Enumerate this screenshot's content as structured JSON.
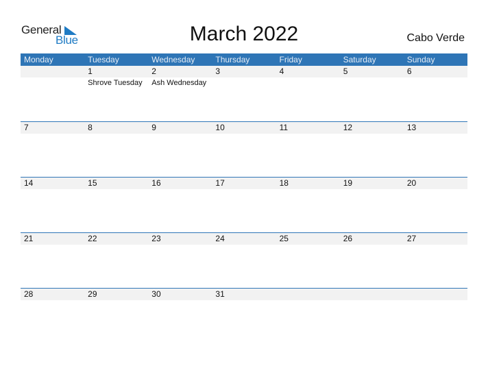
{
  "brand": {
    "general": "General",
    "blue": "Blue"
  },
  "title": "March 2022",
  "country": "Cabo Verde",
  "colors": {
    "accent": "#2e75b6",
    "strip": "#f2f2f2",
    "logo_blue": "#1f7bc4"
  },
  "weekdays": [
    "Monday",
    "Tuesday",
    "Wednesday",
    "Thursday",
    "Friday",
    "Saturday",
    "Sunday"
  ],
  "weeks": [
    [
      {
        "day": ""
      },
      {
        "day": "1",
        "holiday": "Shrove Tuesday"
      },
      {
        "day": "2",
        "holiday": "Ash Wednesday"
      },
      {
        "day": "3"
      },
      {
        "day": "4"
      },
      {
        "day": "5"
      },
      {
        "day": "6"
      }
    ],
    [
      {
        "day": "7"
      },
      {
        "day": "8"
      },
      {
        "day": "9"
      },
      {
        "day": "10"
      },
      {
        "day": "11"
      },
      {
        "day": "12"
      },
      {
        "day": "13"
      }
    ],
    [
      {
        "day": "14"
      },
      {
        "day": "15"
      },
      {
        "day": "16"
      },
      {
        "day": "17"
      },
      {
        "day": "18"
      },
      {
        "day": "19"
      },
      {
        "day": "20"
      }
    ],
    [
      {
        "day": "21"
      },
      {
        "day": "22"
      },
      {
        "day": "23"
      },
      {
        "day": "24"
      },
      {
        "day": "25"
      },
      {
        "day": "26"
      },
      {
        "day": "27"
      }
    ],
    [
      {
        "day": "28"
      },
      {
        "day": "29"
      },
      {
        "day": "30"
      },
      {
        "day": "31"
      },
      {
        "day": ""
      },
      {
        "day": ""
      },
      {
        "day": ""
      }
    ]
  ]
}
